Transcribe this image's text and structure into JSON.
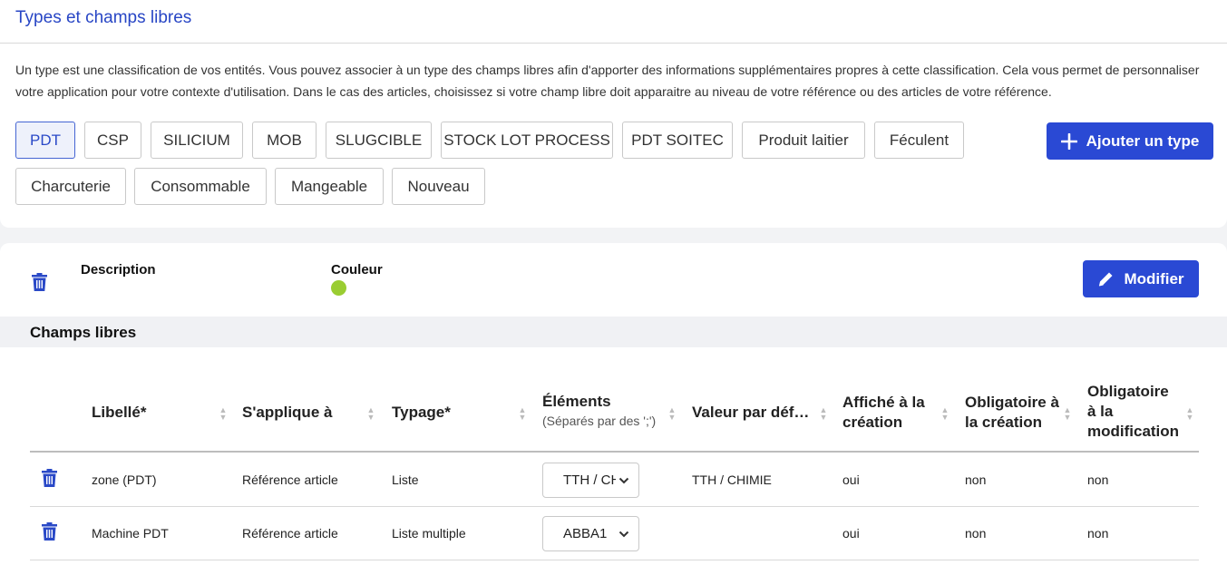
{
  "header": {
    "title": "Types et champs libres",
    "description": "Un type est une classification de vos entités. Vous pouvez associer à un type des champs libres afin d'apporter des informations supplémentaires propres à cette classification. Cela vous permet de personnaliser votre application pour votre contexte d'utilisation. Dans le cas des articles, choisissez si votre champ libre doit apparaitre au niveau de votre référence ou des articles de votre référence."
  },
  "types": [
    "PDT",
    "CSP",
    "SILICIUM",
    "MOB",
    "SLUGCIBLE",
    "STOCK LOT PROCESS",
    "PDT SOITEC",
    "Produit laitier",
    "Féculent",
    "Charcuterie",
    "Consommable",
    "Mangeable",
    "Nouveau"
  ],
  "selected_type": "PDT",
  "add_type_label": "Ajouter un type",
  "detail": {
    "description_label": "Description",
    "couleur_label": "Couleur",
    "couleur_value": "#9acd32",
    "modifier_label": "Modifier"
  },
  "section_title": "Champs libres",
  "table": {
    "headers": [
      {
        "label": "Libellé*"
      },
      {
        "label": "S'applique à"
      },
      {
        "label": "Typage*"
      },
      {
        "label": "Éléments",
        "sub": "(Séparés par des ';')"
      },
      {
        "label": "Valeur par déf…"
      },
      {
        "label": "Affiché à la création"
      },
      {
        "label": "Obligatoire à la création"
      },
      {
        "label": "Obligatoire à la modification"
      }
    ],
    "rows": [
      {
        "libelle": "zone (PDT)",
        "applique": "Référence article",
        "typage": "Liste",
        "elements": "TTH / CHIMIE",
        "defaut": "TTH / CHIMIE",
        "affiche": "oui",
        "oblig_creation": "non",
        "oblig_modif": "non"
      },
      {
        "libelle": "Machine PDT",
        "applique": "Référence article",
        "typage": "Liste multiple",
        "elements": "ABBA1",
        "defaut": "",
        "affiche": "oui",
        "oblig_creation": "non",
        "oblig_modif": "non"
      }
    ]
  },
  "colors": {
    "accent": "#2a49d4",
    "title": "#2846c5",
    "icon": "#2a49c7"
  },
  "icons": {
    "trash": "trash-icon",
    "plus": "plus-icon",
    "pencil": "pencil-icon",
    "sort": "sort-icon",
    "chevron": "chevron-down-icon"
  }
}
